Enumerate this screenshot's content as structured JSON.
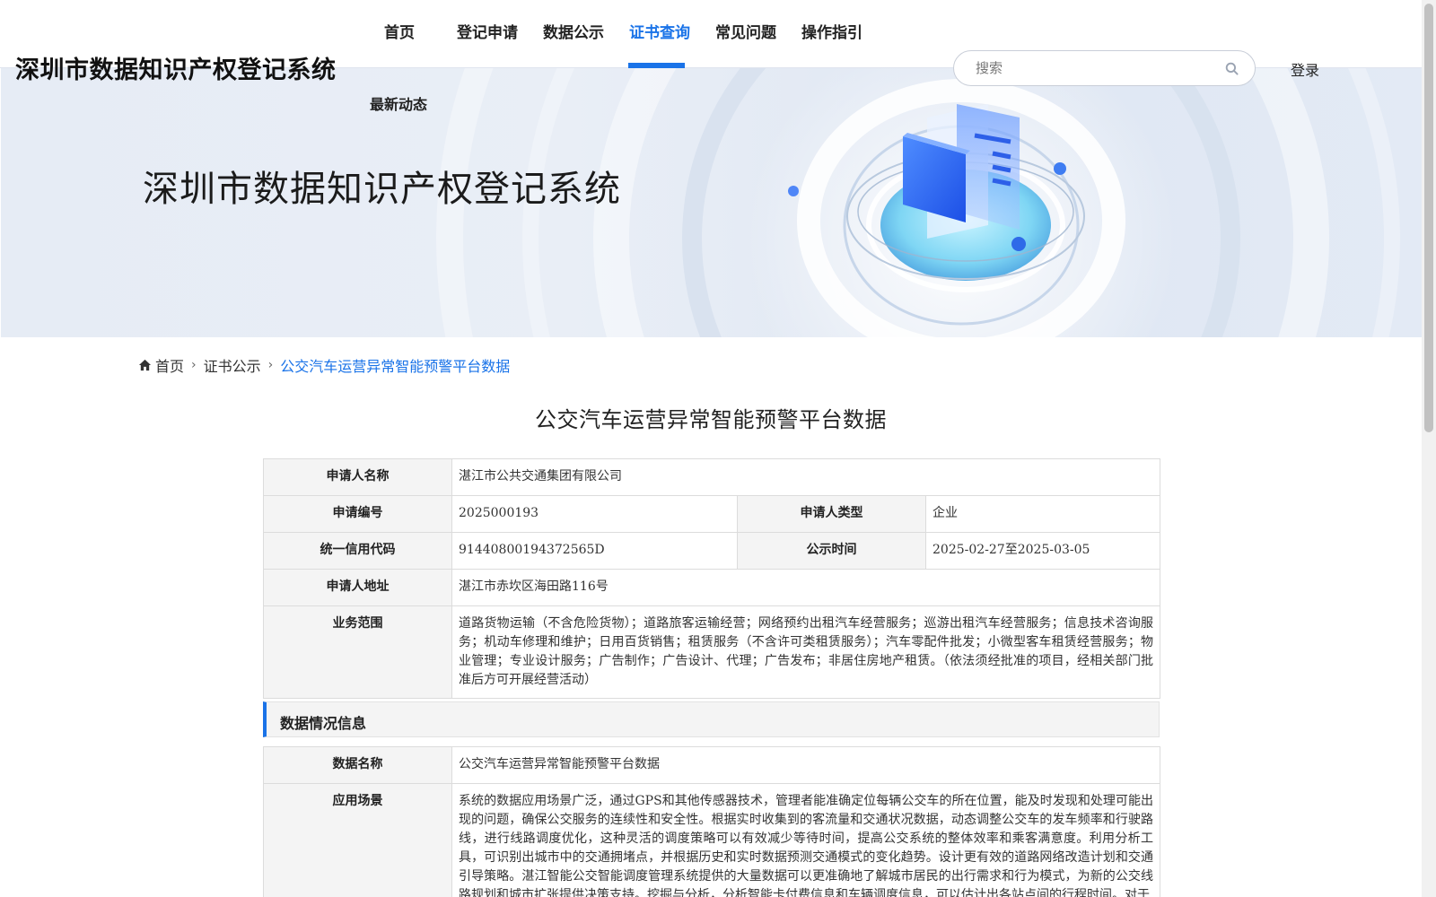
{
  "header": {
    "site_title": "深圳市数据知识产权登记系统",
    "nav": [
      "首页",
      "登记申请",
      "数据公示",
      "证书查询",
      "常见问题",
      "操作指引"
    ],
    "nav_second": "最新动态",
    "active_nav": "证书查询",
    "search_placeholder": "搜索",
    "login": "登录"
  },
  "banner": {
    "title": "深圳市数据知识产权登记系统"
  },
  "breadcrumb": {
    "home": "首页",
    "section": "证书公示",
    "current": "公交汽车运营异常智能预警平台数据"
  },
  "page_title": "公交汽车运营异常智能预警平台数据",
  "applicant": {
    "name_label": "申请人名称",
    "name": "湛江市公共交通集团有限公司",
    "number_label": "申请编号",
    "number": "2025000193",
    "type_label": "申请人类型",
    "type": "企业",
    "credit_label": "统一信用代码",
    "credit": "91440800194372565D",
    "period_label": "公示时间",
    "period": "2025-02-27至2025-03-05",
    "address_label": "申请人地址",
    "address": "湛江市赤坎区海田路116号",
    "scope_label": "业务范围",
    "scope": "道路货物运输（不含危险货物）；道路旅客运输经营；网络预约出租汽车经营服务；巡游出租汽车经营服务；信息技术咨询服务；机动车修理和维护；日用百货销售；租赁服务（不含许可类租赁服务）；汽车零配件批发；小微型客车租赁经营服务；物业管理；专业设计服务；广告制作；广告设计、代理；广告发布；非居住房地产租赁。（依法须经批准的项目，经相关部门批准后方可开展经营活动）"
  },
  "data_section": {
    "title": "数据情况信息",
    "data_name_label": "数据名称",
    "data_name": "公交汽车运营异常智能预警平台数据",
    "scenario_label": "应用场景",
    "scenario": "系统的数据应用场景广泛，通过GPS和其他传感器技术，管理者能准确定位每辆公交车的所在位置，能及时发现和处理可能出现的问题，确保公交服务的连续性和安全性。根据实时收集到的客流量和交通状况数据，动态调整公交车的发车频率和行驶路线，进行线路调度优化，这种灵活的调度策略可以有效减少等待时间，提高公交系统的整体效率和乘客满意度。利用分析工具，可识别出城市中的交通拥堵点，并根据历史和实时数据预测交通模式的变化趋势。设计更有效的道路网络改造计划和交通引导策略。湛江智能公交智能调度管理系统提供的大量数据可以更准确地了解城市居民的出行需求和行为模式，为新的公交线路规划和城市扩张提供决策支持。挖掘与分析，分析智能卡付费信息和车辆调度信息，可以估计出各站点间的行程时间。对于"
  },
  "colors": {
    "accent": "#1a73e8",
    "label_bg": "#f4f4f4"
  },
  "icons": {
    "search": "search-icon",
    "home": "home-icon",
    "breadcrumb_sep": "chevron-right-icon"
  }
}
